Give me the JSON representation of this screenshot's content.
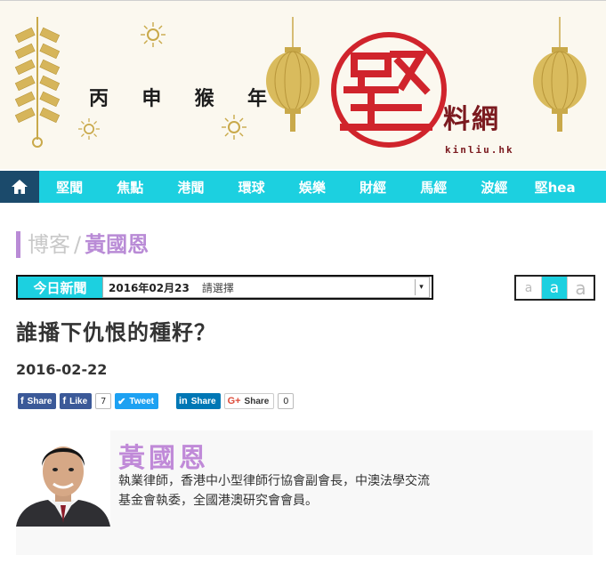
{
  "banner": {
    "greeting": [
      "丙",
      "申",
      "猴",
      "年"
    ],
    "logo_glyph": "堅",
    "logo_text": "料網",
    "logo_url": "kinliu.hk"
  },
  "nav": {
    "home_icon": "home-icon",
    "items": [
      "堅聞",
      "焦點",
      "港聞",
      "環球",
      "娛樂",
      "財經",
      "馬經",
      "波經",
      "堅hea"
    ]
  },
  "breadcrumb": {
    "section": "博客",
    "separator": "/",
    "author": "黃國恩"
  },
  "datebar": {
    "today_label": "今日新聞",
    "date": "2016年02月23",
    "placeholder": "請選擇",
    "arrow": "▾"
  },
  "fontsize": [
    "a",
    "a",
    "a"
  ],
  "article": {
    "headline": "誰播下仇恨的種籽？",
    "date": "2016-02-22"
  },
  "share": {
    "fb_share": "Share",
    "fb_like": "Like",
    "fb_like_count": "7",
    "tweet": "Tweet",
    "linkedin_share": "Share",
    "gplus_share": "Share",
    "gplus_count": "0"
  },
  "author": {
    "name": "黃國恩",
    "bio_line1": "執業律師，香港中小型律師行協會副會長，中澳法學交流",
    "bio_line2": "基金會執委，全國港澳研究會會員。"
  },
  "colors": {
    "accent": "#1cd0e0",
    "nav_home": "#1b4a6b",
    "purple": "#b98bd6",
    "logo_red": "#d0242c",
    "gold": "#c9a94a"
  }
}
